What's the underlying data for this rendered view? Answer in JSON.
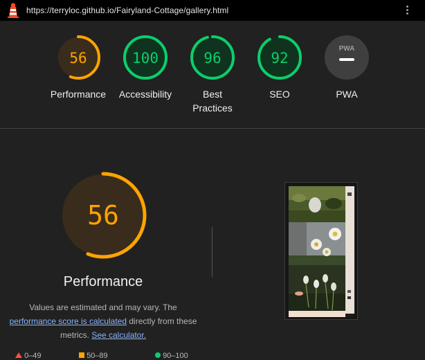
{
  "topbar": {
    "url": "https://terryloc.github.io/Fairyland-Cottage/gallery.html",
    "logo_icon": "lighthouse-icon",
    "menu_icon": "kebab-menu-icon"
  },
  "gauges": [
    {
      "score": 56,
      "label": "Performance",
      "color": "#ffa400",
      "fraction": 0.56
    },
    {
      "score": 100,
      "label": "Accessibility",
      "color": "#0cce6b",
      "fraction": 1.0
    },
    {
      "score": 96,
      "label_line1": "Best",
      "label_line2": "Practices",
      "color": "#0cce6b",
      "fraction": 0.96
    },
    {
      "score": 92,
      "label": "SEO",
      "color": "#0cce6b",
      "fraction": 0.92
    },
    {
      "badge": "PWA",
      "label": "PWA",
      "color": "#9e9e9e"
    }
  ],
  "performance": {
    "score": 56,
    "title": "Performance",
    "desc_line1": "Values are estimated and may vary. The",
    "link_score": "performance score is calculated",
    "desc_mid": "directly from these",
    "desc_prefix": "metrics.",
    "link_calc": "See calculator."
  },
  "legend": [
    {
      "range": "0–49",
      "color": "#ff4e42"
    },
    {
      "range": "50–89",
      "color": "#ffa400"
    },
    {
      "range": "90–100",
      "color": "#0cce6b"
    }
  ],
  "colors": {
    "background": "#212121",
    "orange": "#ffa400",
    "green": "#0cce6b"
  }
}
